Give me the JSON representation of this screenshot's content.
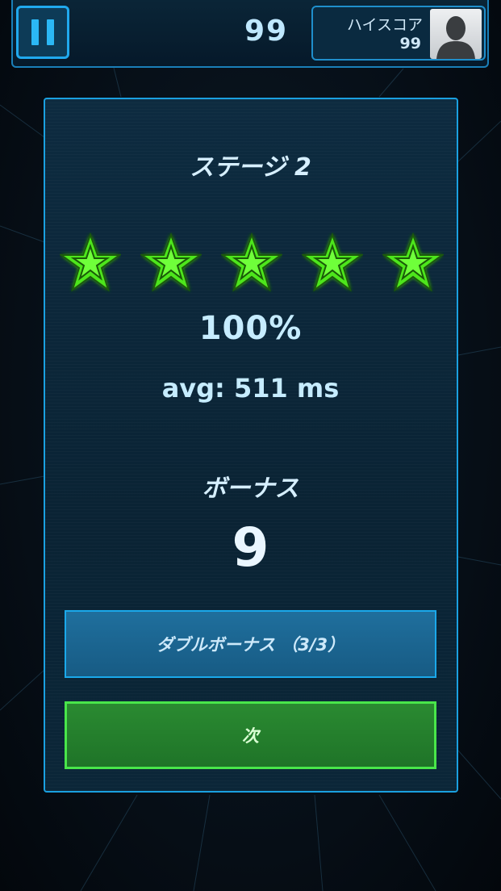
{
  "header": {
    "current_score": "99",
    "highscore_label": "ハイスコア",
    "highscore_value": "99"
  },
  "result": {
    "stage_title": "ステージ 2",
    "stars_earned": 5,
    "stars_total": 5,
    "accuracy": "100%",
    "average_time": "avg: 511 ms",
    "bonus_label": "ボーナス",
    "bonus_value": "9"
  },
  "buttons": {
    "double_bonus_label": "ダブルボーナス （3/3）",
    "next_label": "次"
  },
  "colors": {
    "accent_blue": "#1aa8ea",
    "star_green": "#5bff2a",
    "next_green": "#49e64a"
  }
}
